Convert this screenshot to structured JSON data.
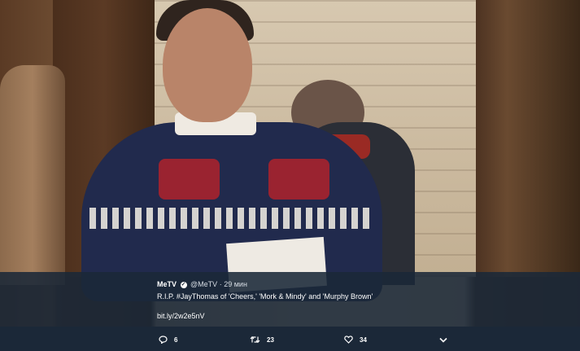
{
  "tweet": {
    "display_name": "MeTV",
    "handle": "@MeTV",
    "separator": "·",
    "time": "29 мин",
    "text": "R.I.P. #JayThomas of 'Cheers,' 'Mork & Mindy' and 'Murphy Brown'",
    "link": "bit.ly/2w2e5nV"
  },
  "actions": {
    "replies": "6",
    "retweets": "23",
    "likes": "34"
  },
  "icons": {
    "reply": "reply-icon",
    "retweet": "retweet-icon",
    "like": "heart-icon",
    "more": "chevron-down-icon",
    "verified": "verified-badge-icon"
  },
  "colors": {
    "caption_bg": "#1a2838",
    "text": "#ffffff"
  }
}
